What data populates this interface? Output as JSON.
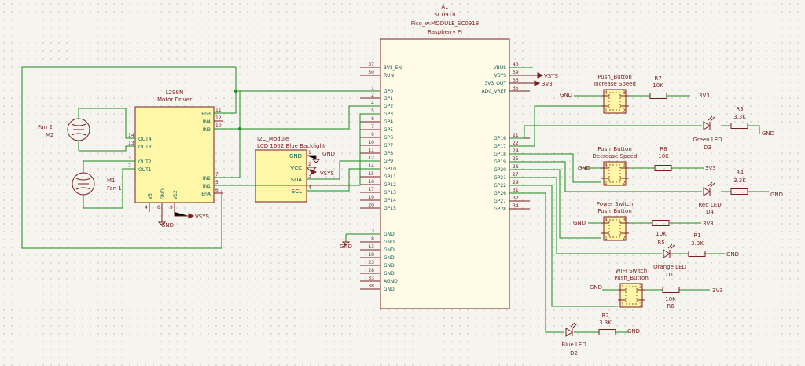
{
  "pico": {
    "ref": "A1",
    "value": "SC0918",
    "footprint": "Pico_w:MODULE_SC0918",
    "subtitle": "Raspberry Pi",
    "left_pins": [
      {
        "num": "37",
        "name": "3V3_EN"
      },
      {
        "num": "30",
        "name": "RUN"
      },
      {
        "num": "1",
        "name": "GP0"
      },
      {
        "num": "2",
        "name": "GP1"
      },
      {
        "num": "4",
        "name": "GP2"
      },
      {
        "num": "5",
        "name": "GP3"
      },
      {
        "num": "6",
        "name": "GP4"
      },
      {
        "num": "7",
        "name": "GP5"
      },
      {
        "num": "9",
        "name": "GP6"
      },
      {
        "num": "10",
        "name": "GP7"
      },
      {
        "num": "11",
        "name": "GP8"
      },
      {
        "num": "12",
        "name": "GP9"
      },
      {
        "num": "14",
        "name": "GP10"
      },
      {
        "num": "15",
        "name": "GP11"
      },
      {
        "num": "16",
        "name": "GP12"
      },
      {
        "num": "17",
        "name": "GP13"
      },
      {
        "num": "19",
        "name": "GP14"
      },
      {
        "num": "20",
        "name": "GP15"
      },
      {
        "num": "3",
        "name": "GND"
      },
      {
        "num": "8",
        "name": "GND"
      },
      {
        "num": "13",
        "name": "GND"
      },
      {
        "num": "18",
        "name": "GND"
      },
      {
        "num": "23",
        "name": "GND"
      },
      {
        "num": "28",
        "name": "GND"
      },
      {
        "num": "33",
        "name": "AGND"
      },
      {
        "num": "38",
        "name": "GND"
      }
    ],
    "right_pins": [
      {
        "num": "40",
        "name": "VBUS"
      },
      {
        "num": "39",
        "name": "VSYS"
      },
      {
        "num": "36",
        "name": "3V3_OUT"
      },
      {
        "num": "35",
        "name": "ADC_VREF"
      },
      {
        "num": "21",
        "name": "GP16"
      },
      {
        "num": "22",
        "name": "GP17"
      },
      {
        "num": "24",
        "name": "GP18"
      },
      {
        "num": "25",
        "name": "GP19"
      },
      {
        "num": "26",
        "name": "GP20"
      },
      {
        "num": "27",
        "name": "GP21"
      },
      {
        "num": "29",
        "name": "GP22"
      },
      {
        "num": "31",
        "name": "GP26"
      },
      {
        "num": "32",
        "name": "GP27"
      },
      {
        "num": "34",
        "name": "GP28"
      }
    ]
  },
  "l298n": {
    "ref": "L298N",
    "value": "Motor Driver",
    "right_pins": [
      {
        "num": "11",
        "name": "EnB"
      },
      {
        "num": "12",
        "name": "IN4"
      },
      {
        "num": "10",
        "name": "IN3"
      },
      {
        "num": "7",
        "name": "IN2"
      },
      {
        "num": "5",
        "name": "IN1"
      },
      {
        "num": "6",
        "name": "EnA"
      }
    ],
    "left_pins": [
      {
        "num": "14",
        "name": "OUT4"
      },
      {
        "num": "13",
        "name": "OUT3"
      },
      {
        "num": "3",
        "name": "OUT2"
      },
      {
        "num": "2",
        "name": "OUT1"
      }
    ],
    "bottom_pins": [
      {
        "num": "4",
        "name": "V5"
      },
      {
        "num": "8",
        "name": "GND"
      },
      {
        "num": "9",
        "name": "V12"
      }
    ]
  },
  "lcd": {
    "ref": "I2C_Module",
    "value": "LCD 1602 Blue Backlight",
    "pins": [
      {
        "num": "1",
        "name": "GND"
      },
      {
        "num": "2",
        "name": "VCC"
      },
      {
        "num": "3",
        "name": "SDA"
      },
      {
        "num": "4",
        "name": "SCL"
      }
    ]
  },
  "fans": [
    {
      "ref": "M2",
      "value": "Fan 2"
    },
    {
      "ref": "M1",
      "value": "Fan 1"
    }
  ],
  "buttons": [
    {
      "title": "Push_Button",
      "subtitle": "Increase Speed"
    },
    {
      "title": "Push_Button",
      "subtitle": "Decrease Speed"
    },
    {
      "title": "Power Switch",
      "subtitle": "Push_Button"
    },
    {
      "title": "WIFI Switch",
      "subtitle": "Push_Button"
    }
  ],
  "resistors": [
    {
      "ref": "R7",
      "value": "10K"
    },
    {
      "ref": "R3",
      "value": "3.3K"
    },
    {
      "ref": "R8",
      "value": "10K"
    },
    {
      "ref": "R4",
      "value": "3.3K"
    },
    {
      "ref": "R5",
      "value": "10K"
    },
    {
      "ref": "R1",
      "value": "3.3K"
    },
    {
      "ref": "R6",
      "value": "10K"
    },
    {
      "ref": "R2",
      "value": "3.3K"
    }
  ],
  "leds": [
    {
      "ref": "D3",
      "value": "Green LED"
    },
    {
      "ref": "D4",
      "value": "Red LED"
    },
    {
      "ref": "D1",
      "value": "Orange LED"
    },
    {
      "ref": "D2",
      "value": "Blue LED"
    }
  ],
  "nets": {
    "gnd": "GND",
    "vsys": "VSYS",
    "v3": "3V3"
  },
  "pin_labels": {
    "one": "1",
    "two": "2",
    "three": "3",
    "four": "4"
  }
}
